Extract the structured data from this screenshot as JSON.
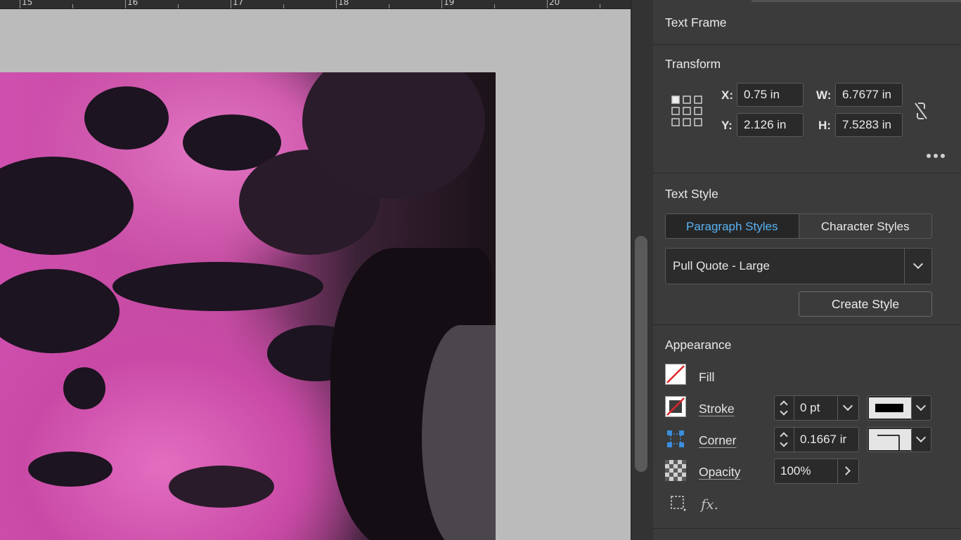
{
  "ruler": {
    "labels": [
      "15",
      "16",
      "17",
      "18",
      "19",
      "20"
    ]
  },
  "panel": {
    "title": "Text Frame",
    "transform": {
      "title": "Transform",
      "x_label": "X:",
      "x_value": "0.75 in",
      "y_label": "Y:",
      "y_value": "2.126 in",
      "w_label": "W:",
      "w_value": "6.7677 in",
      "h_label": "H:",
      "h_value": "7.5283 in"
    },
    "text_style": {
      "title": "Text Style",
      "tabs": [
        "Paragraph Styles",
        "Character Styles"
      ],
      "active_tab": "Paragraph Styles",
      "selected_style": "Pull Quote - Large",
      "create_button": "Create Style"
    },
    "appearance": {
      "title": "Appearance",
      "fill_label": "Fill",
      "stroke_label": "Stroke",
      "stroke_weight": "0 pt",
      "corner_label": "Corner",
      "corner_value": "0.1667 ir",
      "opacity_label": "Opacity",
      "opacity_value": "100%",
      "fx_label": "fx."
    }
  },
  "colors": {
    "accent_tab": "#5ab3f3",
    "fill_none_slash": "#e0262b",
    "stroke_swatch": "#000000",
    "corner_icon": "#3b8fe0"
  }
}
